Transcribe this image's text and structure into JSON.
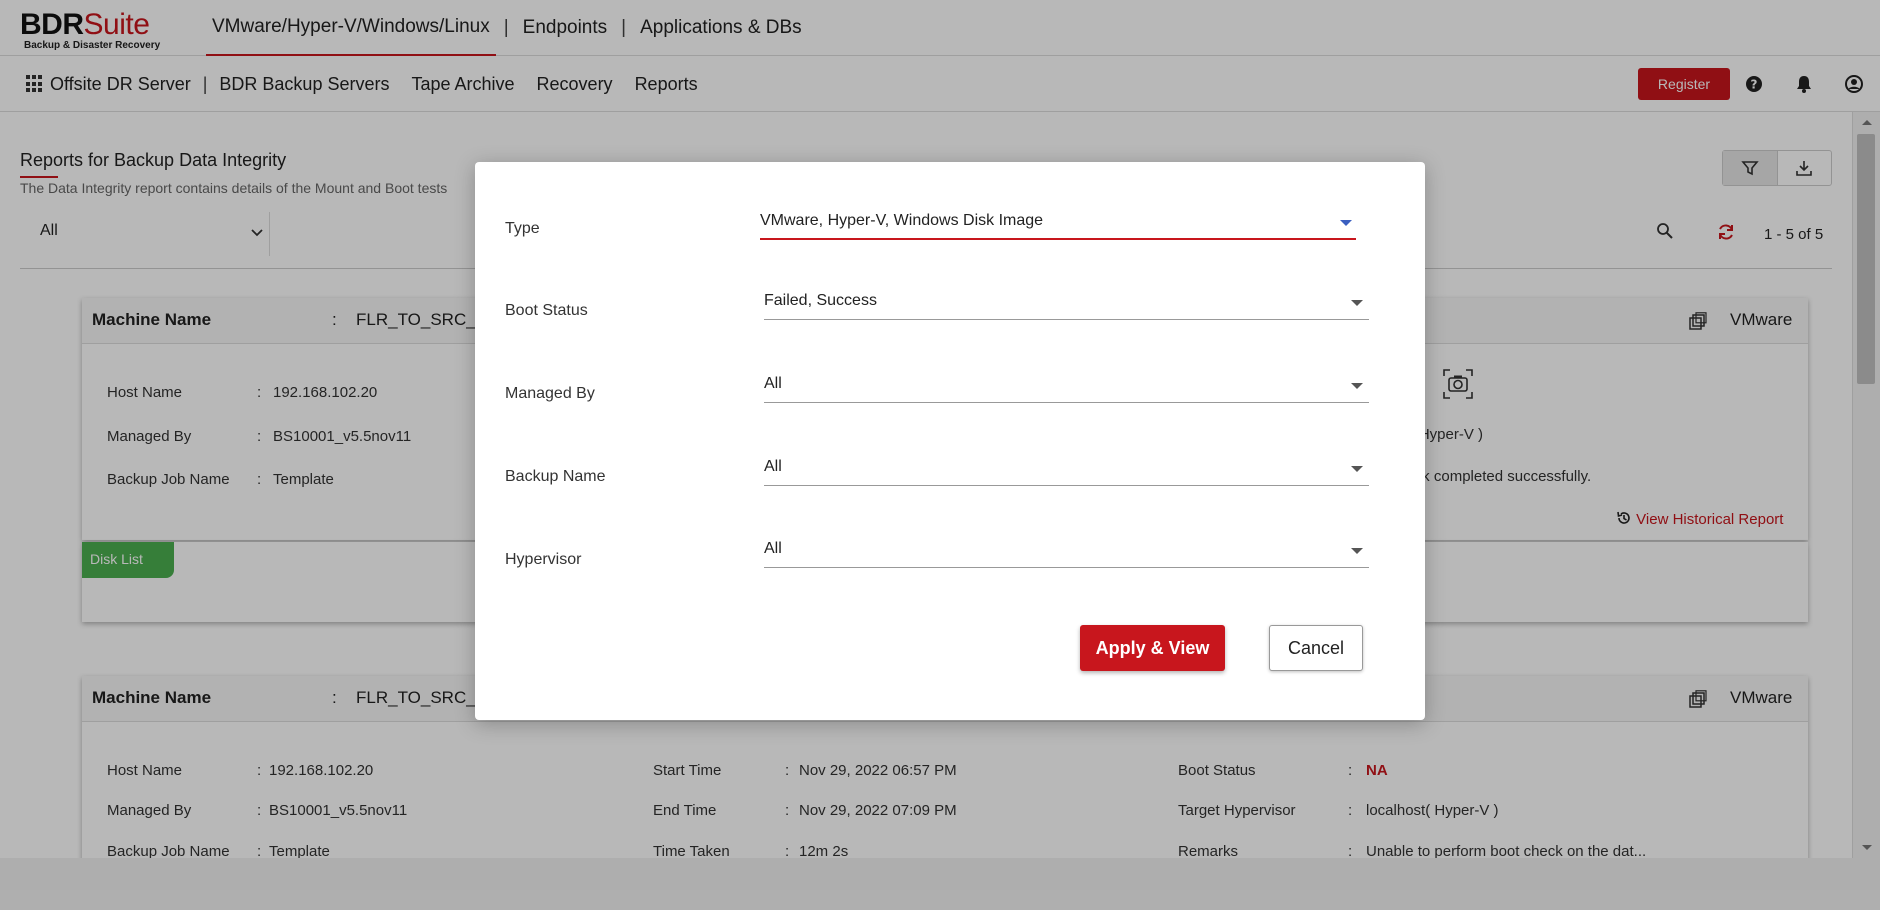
{
  "brand": {
    "name_a": "BDR",
    "name_b": "Suite",
    "tagline": "Backup & Disaster Recovery"
  },
  "top_nav": [
    {
      "label": "VMware/Hyper-V/Windows/Linux"
    },
    {
      "label": "Endpoints"
    },
    {
      "label": "Applications & DBs"
    }
  ],
  "top_nav_sep": "|",
  "sub_nav": {
    "server": "Offsite DR Server",
    "pipe": "|",
    "items": [
      "BDR Backup Servers",
      "Tape Archive",
      "Recovery",
      "Reports"
    ]
  },
  "header_actions": {
    "register_label": "Register"
  },
  "page": {
    "title": "Reports for Backup Data Integrity",
    "description": "The Data Integrity report contains details of the Mount and Boot tests",
    "filter_value": "All",
    "pagination": "1 - 5 of 5"
  },
  "cards": [
    {
      "machine_label": "Machine Name",
      "machine_value": "FLR_TO_SRC_M",
      "hypervisor": "VMware",
      "host_label": "Host Name",
      "host_value": "192.168.102.20",
      "managed_label": "Managed By",
      "managed_value": "BS10001_v5.5nov11",
      "job_label": "Backup Job Name",
      "job_value": "Template",
      "target_partial": "st( Hyper-V )",
      "remarks_partial": "heck completed successfully.",
      "historical_link": "View Historical Report",
      "disk_list": "Disk List"
    },
    {
      "machine_label": "Machine Name",
      "machine_value": "FLR_TO_SRC_M",
      "hypervisor": "VMware",
      "host_label": "Host Name",
      "host_value": "192.168.102.20",
      "managed_label": "Managed By",
      "managed_value": "BS10001_v5.5nov11",
      "job_label": "Backup Job Name",
      "job_value": "Template",
      "start_label": "Start Time",
      "start_value": "Nov 29, 2022 06:57 PM",
      "end_label": "End Time",
      "end_value": "Nov 29, 2022 07:09 PM",
      "taken_label": "Time Taken",
      "taken_value": "12m 2s",
      "boot_label": "Boot Status",
      "boot_value": "NA",
      "target_label": "Target Hypervisor",
      "target_value": "localhost( Hyper-V )",
      "remarks_label": "Remarks",
      "remarks_value": "Unable to perform boot check on the dat..."
    }
  ],
  "colon": ":",
  "modal": {
    "fields": [
      {
        "label": "Type",
        "value": "VMware, Hyper-V, Windows Disk Image"
      },
      {
        "label": "Boot Status",
        "value": "Failed, Success"
      },
      {
        "label": "Managed By",
        "value": "All"
      },
      {
        "label": "Backup Name",
        "value": "All"
      },
      {
        "label": "Hypervisor",
        "value": "All"
      }
    ],
    "apply_label": "Apply & View",
    "cancel_label": "Cancel"
  },
  "colors": {
    "accent": "#c8161d",
    "disk_tab": "#4caf50",
    "na_status": "#c8161d"
  }
}
